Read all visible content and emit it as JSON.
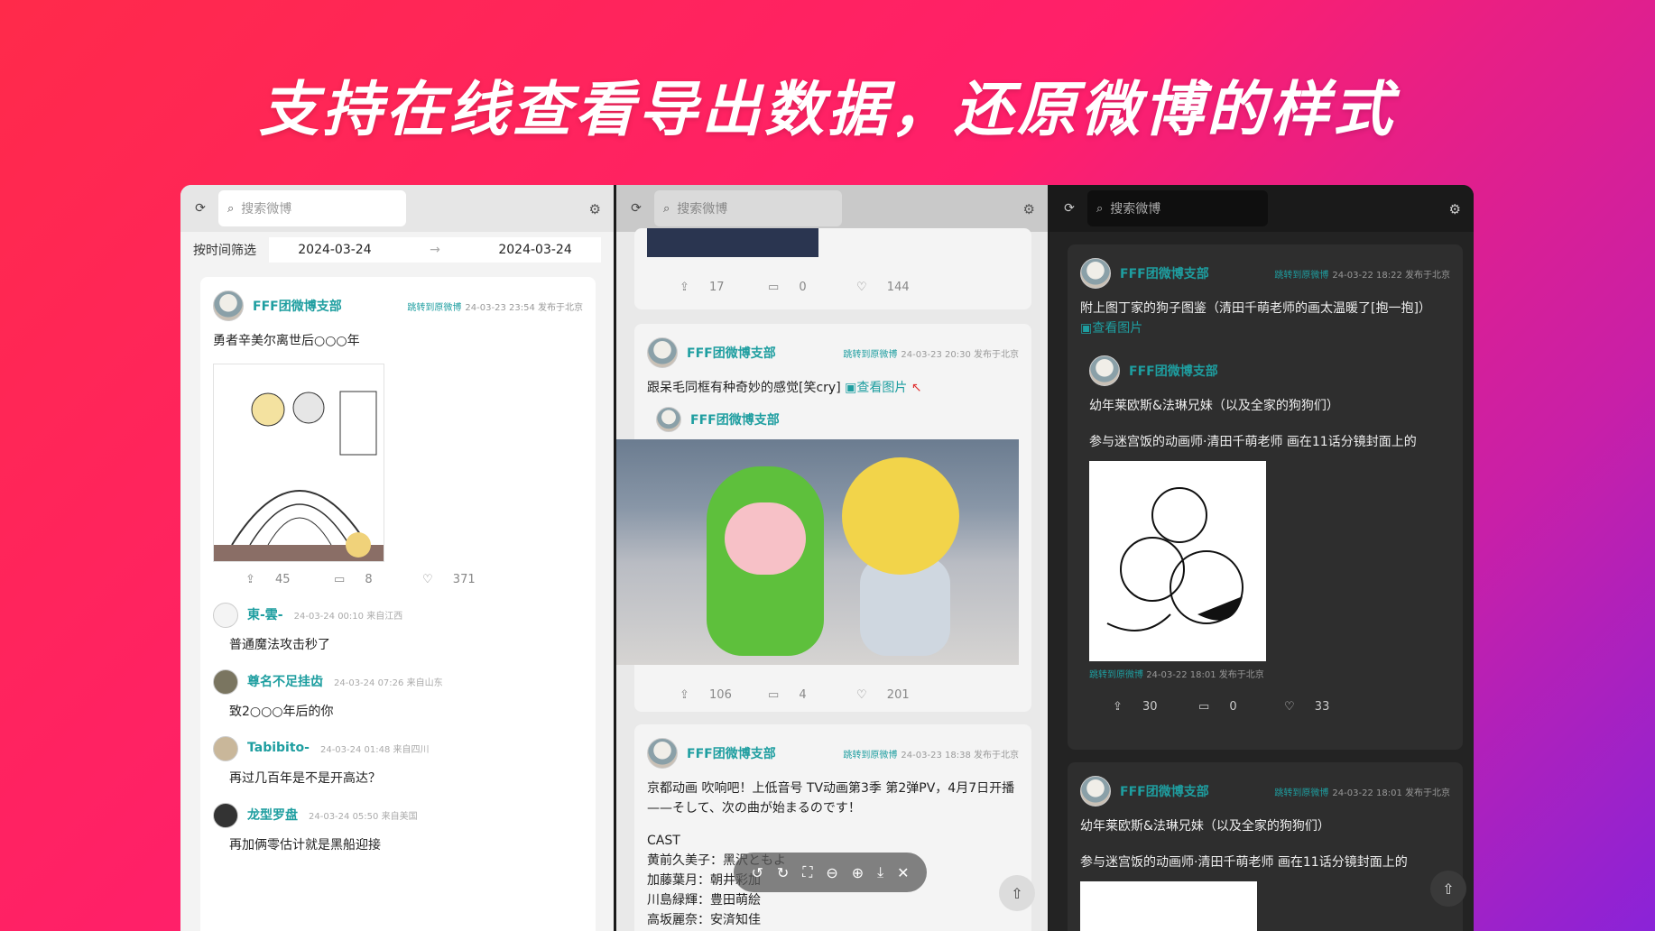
{
  "headline": "支持在线查看导出数据，还原微博的样式",
  "search": {
    "placeholder": "搜索微博"
  },
  "filter": {
    "label": "按时间筛选",
    "start": "2024-03-24",
    "end": "2024-03-24"
  },
  "light_post": {
    "username": "FFF团微博支部",
    "link": "跳转到原微博",
    "meta": "24-03-23 23:54 发布于北京",
    "text": "勇者辛美尔离世后○○○年",
    "reposts": "45",
    "comments": "8",
    "likes": "371"
  },
  "comments": [
    {
      "name": "東-雲-",
      "meta": "24-03-24 00:10 来自江西",
      "text": "普通魔法攻击秒了"
    },
    {
      "name": "尊名不足挂齿",
      "meta": "24-03-24 07:26 来自山东",
      "text": "致2○○○年后的你"
    },
    {
      "name": "Tabibito-",
      "meta": "24-03-24 01:48 来自四川",
      "text": "再过几百年是不是开高达？"
    },
    {
      "name": "龙型罗盘",
      "meta": "24-03-24 05:50 来自美国",
      "text": "再加俩零估计就是黑船迎接"
    }
  ],
  "mid_top_stats": {
    "reposts": "17",
    "comments": "0",
    "likes": "144"
  },
  "mid_post1": {
    "username": "FFF团微博支部",
    "link": "跳转到原微博",
    "meta": "24-03-23 20:30 发布于北京",
    "text": "跟呆毛同框有种奇妙的感觉[笑cry]",
    "view_image": "查看图片",
    "retweet_user": "FFF团微博支部",
    "reposts": "106",
    "comments": "4",
    "likes": "201"
  },
  "mid_post2": {
    "username": "FFF团微博支部",
    "link": "跳转到原微博",
    "meta": "24-03-23 18:38 发布于北京",
    "line1": "京都动画  吹响吧！上低音号 TV动画第3季 第2弹PV，4月7日开播",
    "line2": "——そして、次の曲が始まるのです！",
    "line3": "CAST",
    "line4": "黄前久美子：黑沢ともよ",
    "line5": "加藤葉月：朝井彩加",
    "line6": "川島緑輝：豊田萌絵",
    "line7": "高坂麗奈：安済知佳"
  },
  "dark_post1": {
    "username": "FFF团微博支部",
    "link": "跳转到原微博",
    "meta": "24-03-22 18:22 发布于北京",
    "text": "附上图丁家的狗子图鉴（清田千萌老师的画太温暖了[抱一抱]）",
    "view_image": "查看图片",
    "retweet_user": "FFF团微博支部",
    "retweet_text1": "幼年莱欧斯&法琳兄妹（以及全家的狗狗们）",
    "retweet_text2": "参与迷宫饭的动画师·清田千萌老师 画在11话分镜封面上的",
    "retweet_link": "跳转到原微博",
    "retweet_meta": "24-03-22 18:01 发布于北京",
    "reposts": "30",
    "comments": "0",
    "likes": "33"
  },
  "dark_post2": {
    "username": "FFF团微博支部",
    "link": "跳转到原微博",
    "meta": "24-03-22 18:01 发布于北京",
    "text1": "幼年莱欧斯&法琳兄妹（以及全家的狗狗们）",
    "text2": "参与迷宫饭的动画师·清田千萌老师 画在11话分镜封面上的"
  },
  "icons": {
    "refresh": "refresh-icon",
    "search": "search-icon",
    "gear": "gear-icon",
    "repost": "repost-icon",
    "comment": "comment-icon",
    "like": "heart-icon",
    "rocket": "rocket-icon"
  },
  "colors": {
    "accent": "#1e9ea0",
    "bg_start": "#ff2a4a",
    "bg_end": "#8a23d8"
  }
}
